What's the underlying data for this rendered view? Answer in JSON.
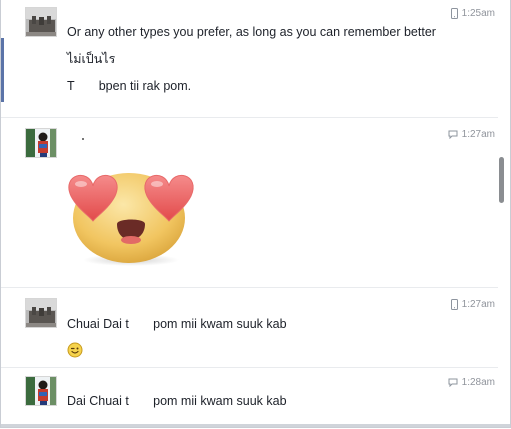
{
  "messages": [
    {
      "time": "1:25am",
      "time_icon": "mobile-icon",
      "paragraphs": [
        "Or any other types you prefer, as long as you can remember better",
        "ไม่เป็นไร",
        "T       bpen tii rak pom."
      ]
    },
    {
      "time": "1:27am",
      "time_icon": "chat-bubble-icon",
      "sticker": "heart-eyes-emoji-sticker"
    },
    {
      "time": "1:27am",
      "time_icon": "mobile-icon",
      "paragraphs": [
        "Chuai Dai t       pom mii kwam suuk kab"
      ],
      "emoji": "wink-smiley-icon"
    },
    {
      "time": "1:28am",
      "time_icon": "chat-bubble-icon",
      "paragraphs": [
        "Dai Chuai t       pom mii kwam suuk kab"
      ]
    }
  ],
  "colors": {
    "text": "#1d2129",
    "timestamp": "#90949c",
    "accent": "#5b74a8"
  }
}
